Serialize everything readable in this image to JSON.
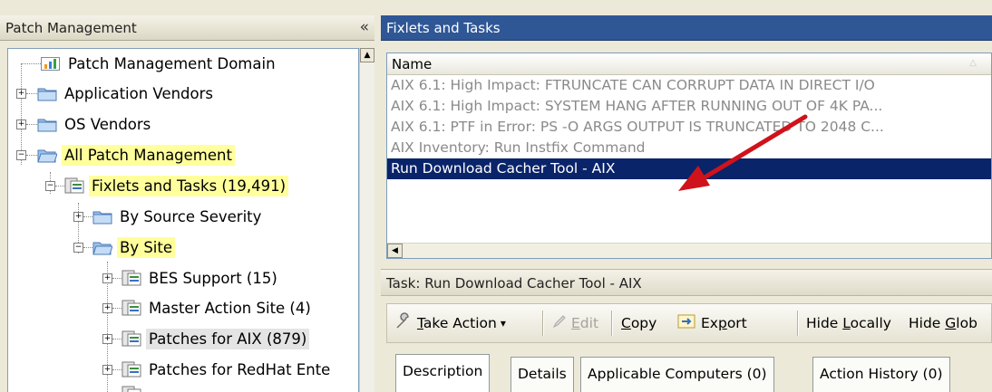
{
  "left_pane": {
    "title": "Patch Management",
    "collapse_glyph": "«",
    "tree": [
      {
        "label": "Patch Management Domain",
        "icon": "domain-chart-icon"
      },
      {
        "label": "Application Vendors",
        "icon": "folder-icon",
        "expander": "+"
      },
      {
        "label": "OS Vendors",
        "icon": "folder-icon",
        "expander": "+"
      },
      {
        "label": "All Patch Management",
        "icon": "open-folder-icon",
        "expander": "−",
        "highlighted": true
      },
      {
        "label": "Fixlets and Tasks (19,491)",
        "icon": "fixlet-list-icon",
        "expander": "−",
        "highlighted": true
      },
      {
        "label": "By Source Severity",
        "icon": "folder-icon",
        "expander": "+"
      },
      {
        "label": "By Site",
        "icon": "open-folder-icon",
        "expander": "−",
        "highlighted": true
      },
      {
        "label": "BES Support (15)",
        "icon": "site-icon",
        "expander": "+"
      },
      {
        "label": "Master Action Site (4)",
        "icon": "site-icon",
        "expander": "+"
      },
      {
        "label": "Patches for AIX (879)",
        "icon": "site-icon",
        "expander": "+",
        "selected": true
      },
      {
        "label": "Patches for RedHat Ente",
        "icon": "site-icon",
        "expander": "+"
      }
    ]
  },
  "right_pane": {
    "title": "Fixlets and Tasks",
    "list": {
      "column_header": "Name",
      "sort_glyph": "△",
      "rows": [
        "AIX 6.1: High Impact: FTRUNCATE CAN CORRUPT DATA IN DIRECT I/O",
        "AIX 6.1: High Impact: SYSTEM HANG AFTER RUNNING OUT OF 4K PA...",
        "AIX 6.1: PTF in Error: PS -O ARGS OUTPUT IS TRUNCATED TO 2048 C...",
        "AIX Inventory: Run Instfix Command",
        "Run Download Cacher Tool - AIX"
      ],
      "selected_index": 4
    },
    "task_title": "Task: Run Download Cacher Tool - AIX",
    "toolbar": {
      "take_action": "Take Action",
      "take_action_arrow": "▾",
      "edit": "Edit",
      "copy": "Copy",
      "export": "Export",
      "hide_locally": "Hide Locally",
      "hide_globally": "Hide Glob"
    },
    "tabs": [
      "Description",
      "Details",
      "Applicable Computers (0)",
      "Action History (0)"
    ]
  },
  "colors": {
    "header_blue": "#2f5796",
    "selection_navy": "#0a246a",
    "highlight_yellow": "#ffff9c",
    "arrow_red": "#d0121b"
  }
}
